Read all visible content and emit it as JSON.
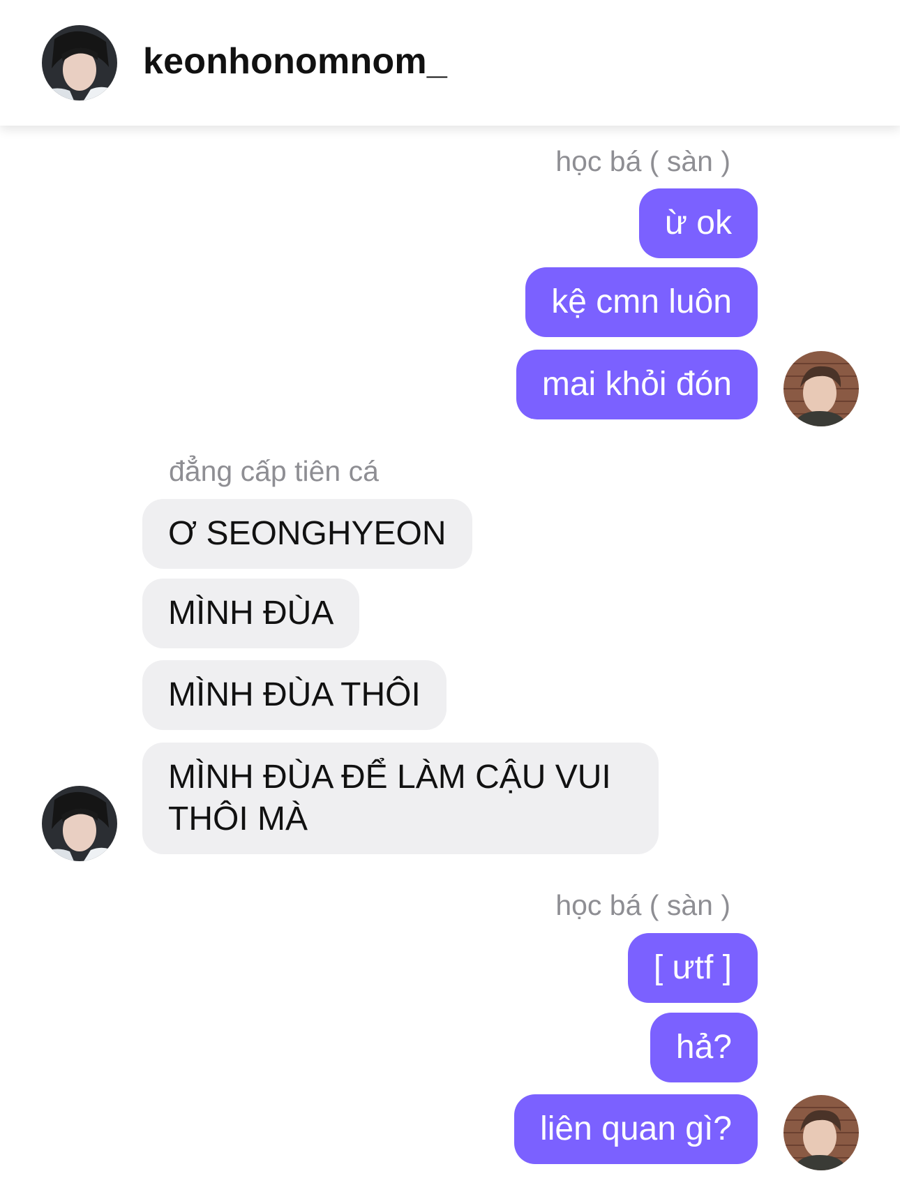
{
  "header": {
    "contact_name": "keonhonomnom_",
    "avatar_icon": "contact-avatar-icon"
  },
  "colors": {
    "outgoing_bubble": "#7b61ff",
    "incoming_bubble": "#efeff1",
    "sender_label": "#8e8e93"
  },
  "thread": [
    {
      "sender": "học bá ( sàn )",
      "direction": "outgoing",
      "messages": [
        "ừ ok",
        "kệ cmn luôn",
        "mai khỏi đón"
      ]
    },
    {
      "sender": "đẳng cấp tiên cá",
      "direction": "incoming",
      "messages": [
        "Ơ SEONGHYEON",
        "MÌNH ĐÙA",
        "MÌNH ĐÙA THÔI",
        "MÌNH ĐÙA ĐỂ LÀM CẬU VUI THÔI MÀ"
      ]
    },
    {
      "sender": "học bá ( sàn )",
      "direction": "outgoing",
      "messages": [
        "[ ưtf ]",
        "hả?",
        "liên quan gì?"
      ]
    }
  ]
}
